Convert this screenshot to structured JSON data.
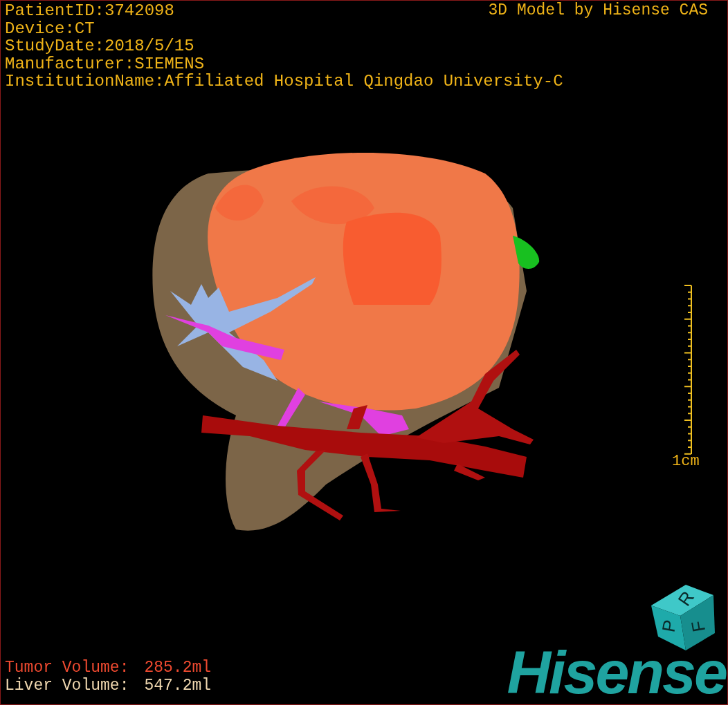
{
  "info_lines": [
    "PatientID:3742098",
    "Device:CT",
    "StudyDate:2018/5/15",
    "Manufacturer:SIEMENS",
    "InstitutionName:Affiliated Hospital Qingdao University-C"
  ],
  "title": "3D Model by Hisense CAS",
  "scale_bar": {
    "label": "1cm"
  },
  "volumes": [
    {
      "kind": "tumor",
      "label": "Tumor Volume:",
      "value": "285.2ml"
    },
    {
      "kind": "liver",
      "label": "Liver Volume:",
      "value": "547.2ml"
    }
  ],
  "orientation_cube": {
    "faces": [
      "P",
      "R",
      "F"
    ]
  },
  "logo": "Hisense"
}
